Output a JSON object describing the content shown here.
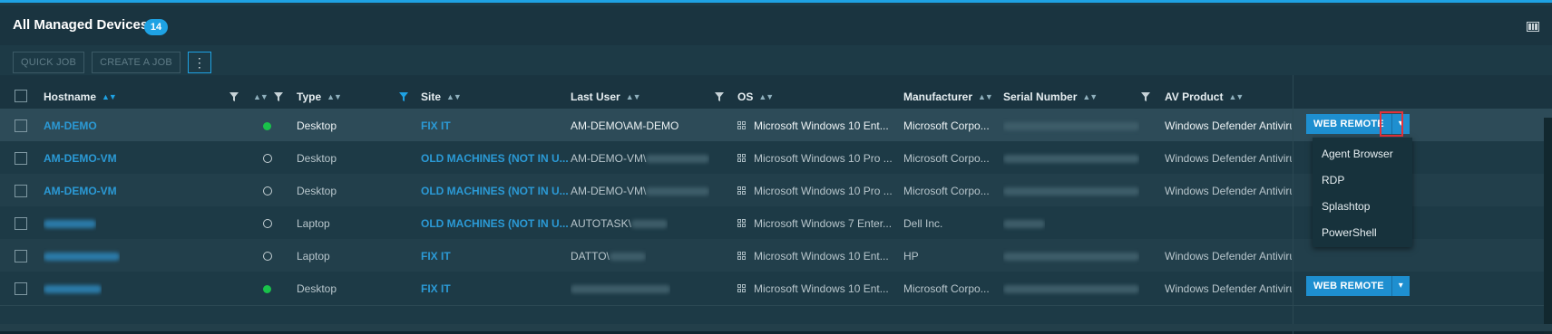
{
  "header": {
    "title": "All Managed Devices",
    "count": "14"
  },
  "toolbar": {
    "quick_job": "QUICK JOB",
    "create_job": "CREATE A JOB",
    "more": "⋮"
  },
  "columns": {
    "hostname": "Hostname",
    "type": "Type",
    "site": "Site",
    "last_user": "Last User",
    "os": "OS",
    "manufacturer": "Manufacturer",
    "serial": "Serial Number",
    "av": "AV Product"
  },
  "rows": [
    {
      "hostname": "AM-DEMO",
      "status": "online",
      "type": "Desktop",
      "site": "FIX IT",
      "last_user": "AM-DEMO\\AM-DEMO",
      "os": "Microsoft Windows 10 Ent...",
      "manufacturer": "Microsoft Corpo...",
      "av": "Windows Defender Antiviru",
      "action": "WEB REMOTE"
    },
    {
      "hostname": "AM-DEMO-VM",
      "status": "offline",
      "type": "Desktop",
      "site": "OLD MACHINES (NOT IN U...",
      "last_user": "AM-DEMO-VM\\",
      "os": "Microsoft Windows 10 Pro ...",
      "manufacturer": "Microsoft Corpo...",
      "av": "Windows Defender Antiviru",
      "action": ""
    },
    {
      "hostname": "AM-DEMO-VM",
      "status": "offline",
      "type": "Desktop",
      "site": "OLD MACHINES (NOT IN U...",
      "last_user": "AM-DEMO-VM\\",
      "os": "Microsoft Windows 10 Pro ...",
      "manufacturer": "Microsoft Corpo...",
      "av": "Windows Defender Antiviru",
      "action": ""
    },
    {
      "hostname": "",
      "status": "offline",
      "type": "Laptop",
      "site": "OLD MACHINES (NOT IN U...",
      "last_user": "AUTOTASK\\",
      "os": "Microsoft Windows 7 Enter...",
      "manufacturer": "Dell Inc.",
      "av": "",
      "action": ""
    },
    {
      "hostname": "",
      "status": "offline",
      "type": "Laptop",
      "site": "FIX IT",
      "last_user": "DATTO\\",
      "os": "Microsoft Windows 10 Ent...",
      "manufacturer": "HP",
      "av": "Windows Defender Antiviru",
      "action": ""
    },
    {
      "hostname": "",
      "status": "online",
      "type": "Desktop",
      "site": "FIX IT",
      "last_user": "",
      "os": "Microsoft Windows 10 Ent...",
      "manufacturer": "Microsoft Corpo...",
      "av": "Windows Defender Antiviru",
      "action": "WEB REMOTE"
    }
  ],
  "dropdown": [
    "Agent Browser",
    "RDP",
    "Splashtop",
    "PowerShell"
  ],
  "colors": {
    "accent": "#1ea2e4",
    "online": "#19c24a",
    "highlight": "#e3323b"
  }
}
